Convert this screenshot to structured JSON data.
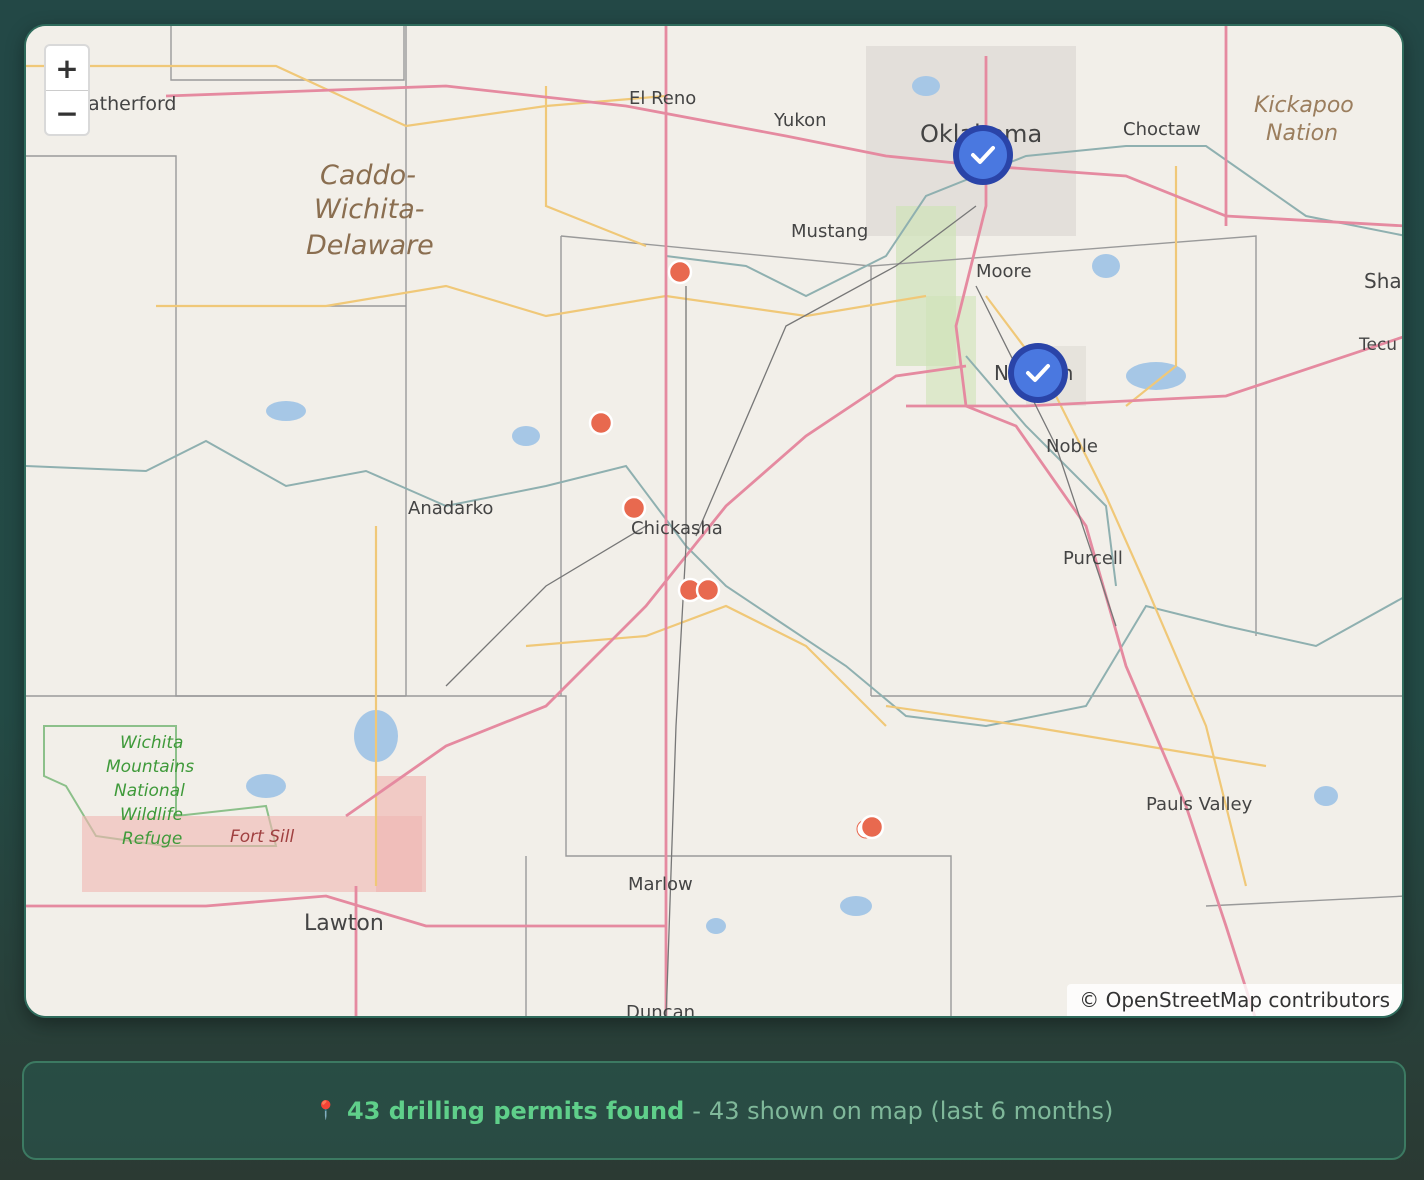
{
  "map": {
    "zoom_in_label": "+",
    "zoom_out_label": "−",
    "attribution": "© OpenStreetMap contributors",
    "place_labels": {
      "weatherford": "atherford",
      "el_reno": "El Reno",
      "yukon": "Yukon",
      "oklahoma_city": "Oklahoma",
      "choctaw": "Choctaw",
      "kickapoo_1": "Kickapoo",
      "kickapoo_2": "Nation",
      "caddo_1": "Caddo-",
      "caddo_2": "Wichita-",
      "caddo_3": "Delaware",
      "mustang": "Mustang",
      "moore": "Moore",
      "shawnee": "Sha",
      "tecumseh": "Tecu",
      "norman": "Norman",
      "noble": "Noble",
      "anadarko": "Anadarko",
      "chickasha": "Chickasha",
      "purcell": "Purcell",
      "wichita_1": "Wichita",
      "wichita_2": "Mountains",
      "wichita_3": "National",
      "wichita_4": "Wildlife",
      "wichita_5": "Refuge",
      "fort_sill": "Fort Sill",
      "pauls_valley": "Pauls Valley",
      "marlow": "Marlow",
      "lawton": "Lawton",
      "duncan": "Duncan"
    },
    "colors": {
      "permit_marker": "#e8694f",
      "verified_marker": "#4a78e0",
      "major_road": "#e58aa0",
      "secondary_road": "#f0c878",
      "water": "#a6c7e6"
    }
  },
  "summary": {
    "icon": "📍",
    "count_text": "43 drilling permits found",
    "separator": "-",
    "detail_text": "43 shown on map (last 6 months)"
  }
}
